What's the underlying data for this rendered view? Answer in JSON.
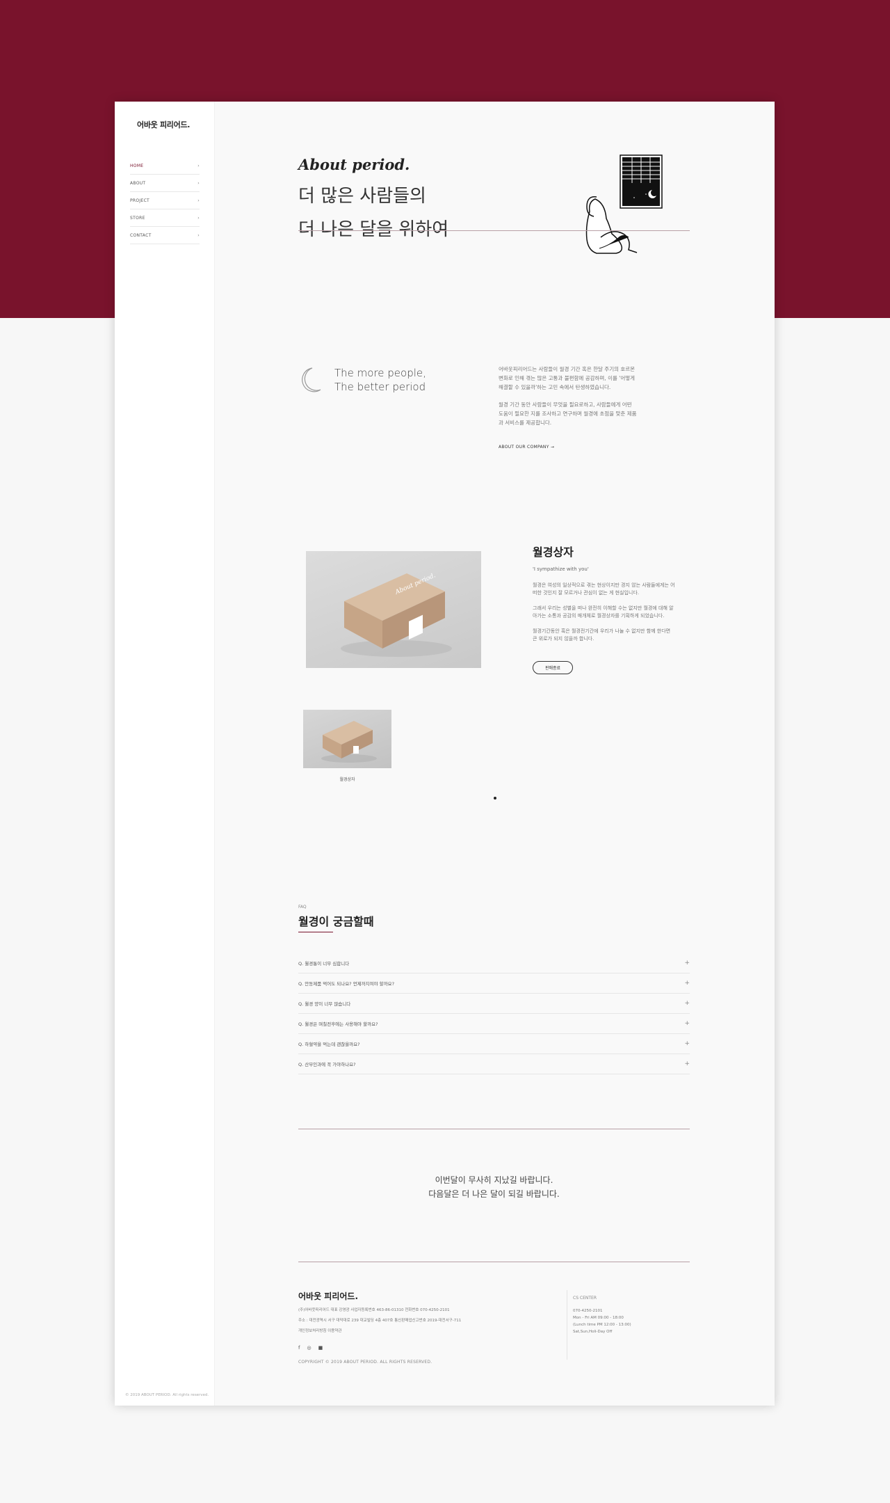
{
  "colors": {
    "brand": "#79132c",
    "rule": "#b8a0a6"
  },
  "brand": {
    "logo": "어바웃 피리어드."
  },
  "nav": [
    {
      "label": "HOME",
      "active": true
    },
    {
      "label": "ABOUT"
    },
    {
      "label": "PROJECT"
    },
    {
      "label": "STORE"
    },
    {
      "label": "CONTACT"
    }
  ],
  "sidebar_copyright": "© 2019 ABOUT PERIOD. All rights reserved.",
  "hero": {
    "en": "About period.",
    "ko_line1": "더 많은 사람들의",
    "ko_line2": "더 나은 달을 위하여"
  },
  "about": {
    "tagline_line1": "The more people,",
    "tagline_line2": "The better period",
    "para1": "어바웃피리어드는 사람들이 월경 기간 혹은 한달 주기의 호르몬 변화로 인해 겪는 많은 고통과 불편함에 공감하며, 이를 '어떻게 해결할 수 있을까'하는 고민 속에서 탄생하였습니다.",
    "para2": "월경 기간 동안 사람들이 무엇을 필요로하고, 사람들에게 어떤 도움이 필요한 지를 조사하고 연구하며 월경에 초점을 맞춘 제품과 서비스를 제공합니다.",
    "link": "ABOUT OUR COMPANY →"
  },
  "product": {
    "title": "월경상자",
    "subtitle": "'I sympathize with you'",
    "desc1": "월경은 여성의 일상적으로 겪는 현상이지만 경지 않는 사람들에게는 어떠한 것인지 잘 모르거나 관심이 없는 게 현실입니다.",
    "desc2": "그래서 우리는 성별을 떠나 완전히 이해할 수는 없지만 월경에 대해 알아가는 소통과 공감의 매개체로 월경상자를 기획하게 되었습니다.",
    "desc3": "월경기간동안 혹은 월경전기간에 우리가 나눌 수 없지만 함께 한다면 큰 위로가 되지 않을까 합니다.",
    "button": "판매종료",
    "box_text": "About period.",
    "thumb_label": "월경상자"
  },
  "faq": {
    "label": "FAQ",
    "title": "월경이 궁금할때",
    "items": [
      "Q. 월경통이 너무 심합니다",
      "Q. 안동제품 먹어도 되나요? 언제까지여야 할까요?",
      "Q. 월경 양이 너무 많습니다",
      "Q. 월경은 며칠전후에는 사용해야 할까요?",
      "Q. 하혈약을 먹는데 괜찮을까요?",
      "Q. 산부인과에 꼭 가야하나요?"
    ]
  },
  "closing": {
    "line1": "이번달이 무사히 지났길 바랍니다.",
    "line2": "다음달은 더 나은 달이 되길 바랍니다."
  },
  "footer": {
    "logo": "어바웃 피리어드.",
    "info1": "(주)어바웃피리어드   대표 강영광   사업자등록번호 463-86-01310   전화번호 070-4250-2101",
    "info2": "주소 : 대전광역시 서구 대덕대로 239 대교빌딩 4층 407호   통신판매업신고번호 2019-대전서구-711",
    "info3": "개인정보처리방침    이용약관",
    "social": [
      "f",
      "◎",
      "■"
    ],
    "copyright": "COPYRIGHT © 2019 ABOUT PERIOD. ALL RIGHTS RESERVED.",
    "cs_title": "CS CENTER",
    "cs_phone": "070-4250-2101",
    "cs_hours": "Mon - Fri AM 09:00 - 18:00",
    "cs_lunch": "(Lunch time PM 12:00 - 13:00)",
    "cs_off": "Sat,Sun,Holi-Day Off"
  }
}
